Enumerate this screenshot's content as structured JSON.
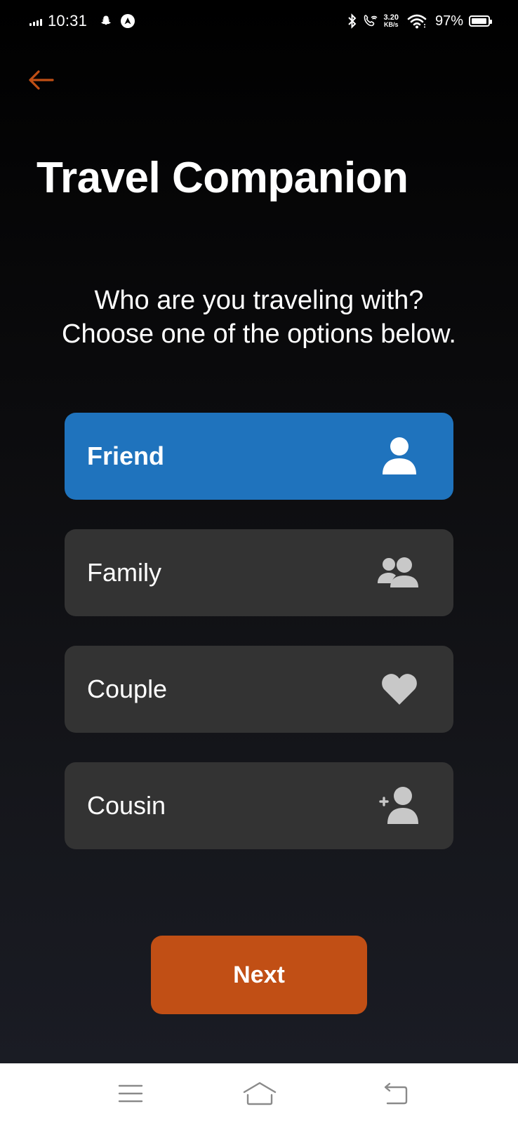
{
  "status_bar": {
    "time": "10:31",
    "net_speed_value": "3.20",
    "net_speed_unit": "KB/s",
    "battery_percent": "97%",
    "battery_level": 0.97
  },
  "header": {
    "back_icon": "arrow-left-icon",
    "title": "Travel Companion"
  },
  "prompt": {
    "line1": "Who are you traveling with?",
    "line2": "Choose one of the options below."
  },
  "options": [
    {
      "label": "Friend",
      "icon": "person-icon",
      "selected": true
    },
    {
      "label": "Family",
      "icon": "people-group-icon",
      "selected": false
    },
    {
      "label": "Couple",
      "icon": "heart-icon",
      "selected": false
    },
    {
      "label": "Cousin",
      "icon": "person-plus-icon",
      "selected": false
    }
  ],
  "next_button": {
    "label": "Next"
  },
  "colors": {
    "accent": "#c14f15",
    "selected": "#1f73bd",
    "option_bg": "#333333",
    "icon_muted": "#c8c8c8"
  }
}
